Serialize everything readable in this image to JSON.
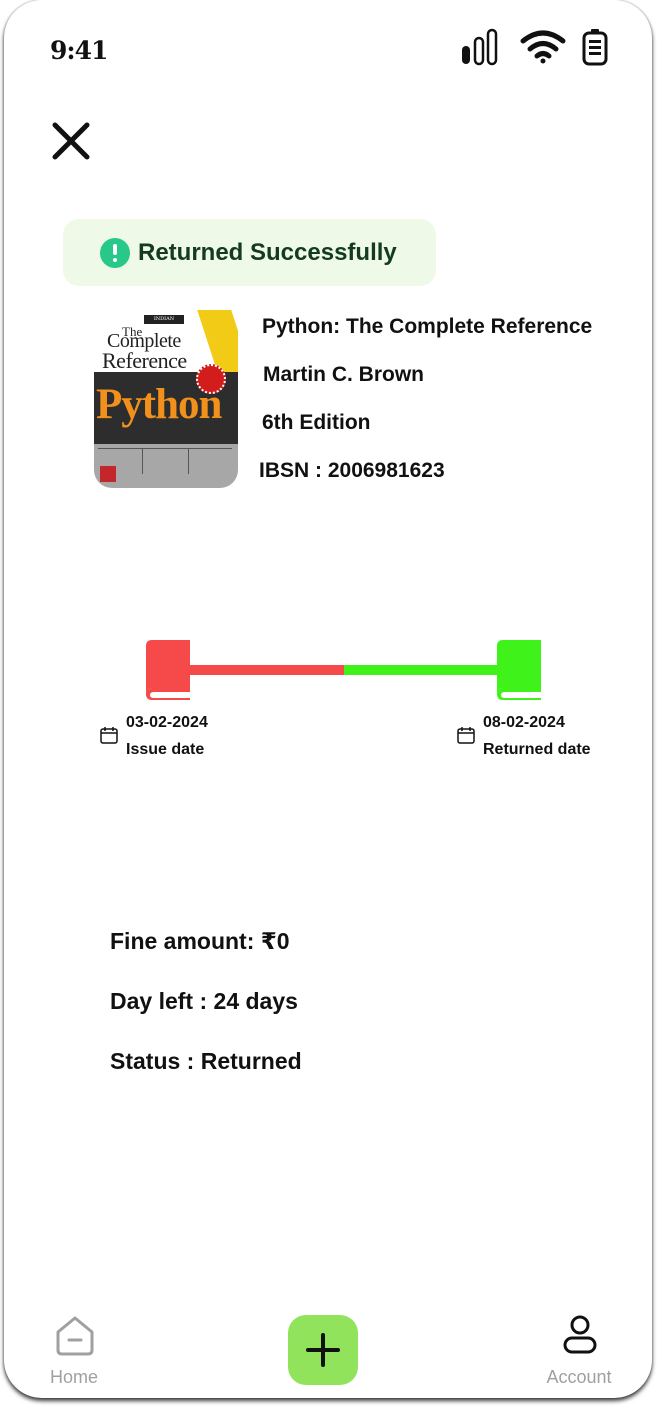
{
  "status_bar": {
    "time": "9:41"
  },
  "toast": {
    "message": "Returned Successfully"
  },
  "book": {
    "title": "Python: The Complete Reference",
    "author": "Martin C. Brown",
    "edition": "6th Edition",
    "isbn": "IBSN : 2006981623",
    "cover": {
      "edition_tag": "INDIAN EDITION",
      "line1": "The",
      "line2": "Complete",
      "line3": "Reference",
      "big_word": "Python"
    }
  },
  "timeline": {
    "issue": {
      "date": "03-02-2024",
      "label": "Issue date"
    },
    "returned": {
      "date": "08-02-2024",
      "label": "Returned date"
    }
  },
  "details": {
    "fine": "Fine amount: ₹0",
    "days_left": "Day left  : 24 days",
    "status": "Status : Returned"
  },
  "bottom_nav": {
    "home_label": "Home",
    "account_label": "Account"
  },
  "colors": {
    "toast_bg": "#eef9e8",
    "toast_icon": "#27c88a",
    "issue_red": "#f64a4a",
    "returned_green": "#3ff21a",
    "add_button": "#90e35b"
  }
}
